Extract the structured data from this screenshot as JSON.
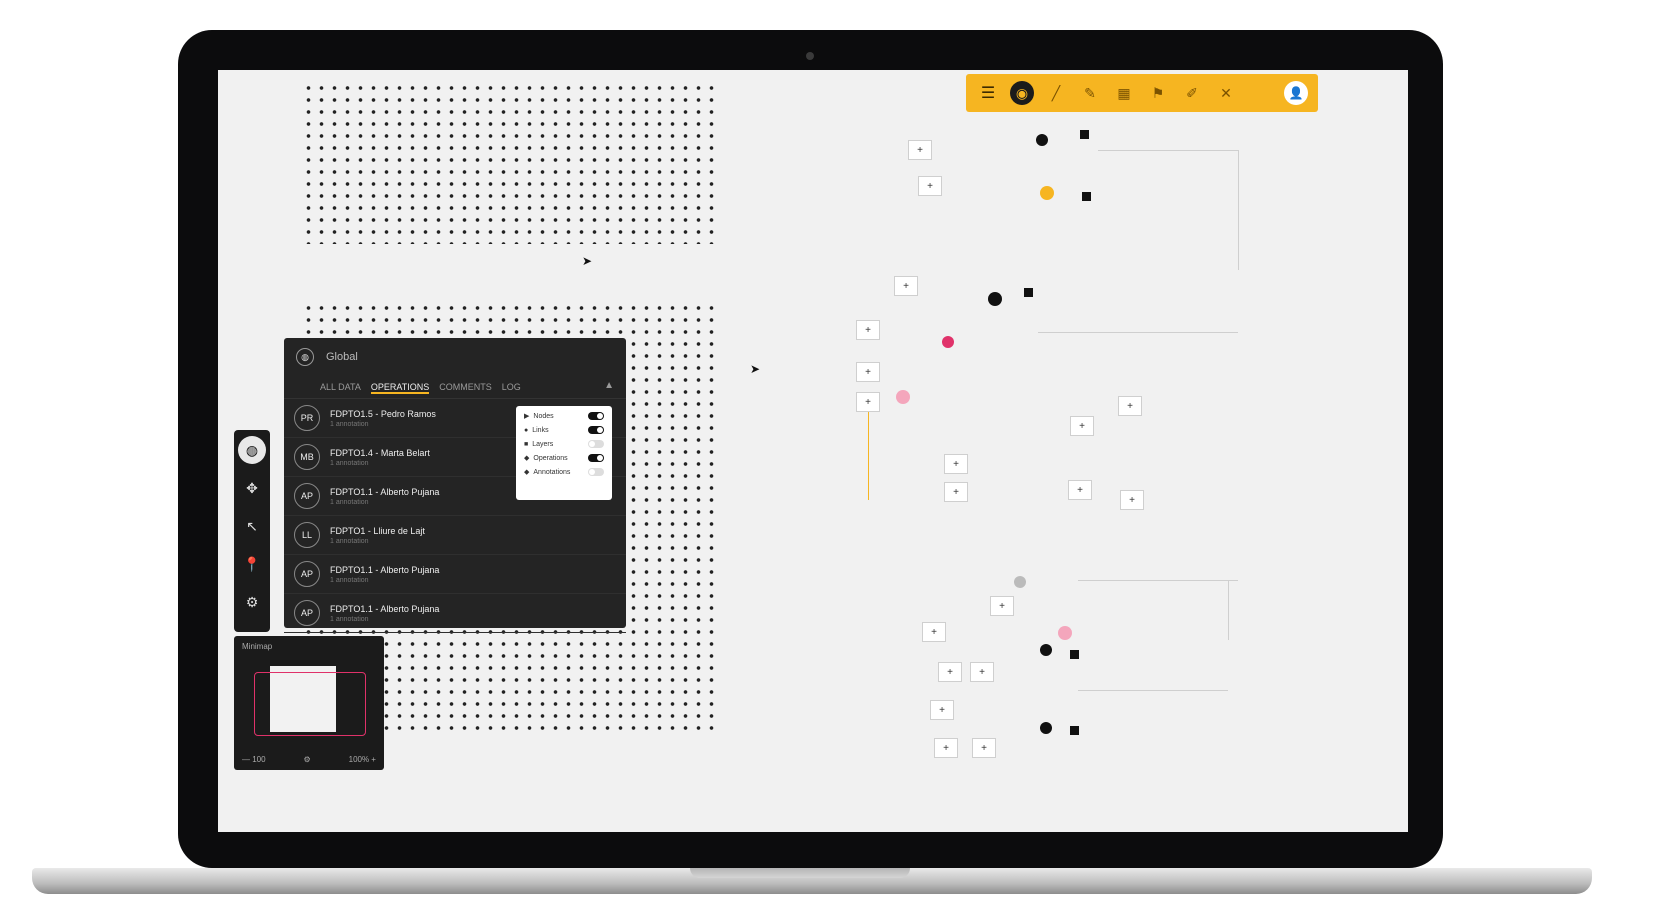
{
  "toolbar": {
    "icons": [
      "layers-icon",
      "target-icon",
      "slash-icon",
      "pen-icon",
      "grid-icon",
      "flag-icon",
      "pencil-icon",
      "close-icon",
      "user-icon"
    ]
  },
  "panel": {
    "title": "Global",
    "tabs": [
      "ALL DATA",
      "OPERATIONS",
      "COMMENTS",
      "LOG"
    ],
    "active_tab": 1,
    "rows": [
      {
        "initials": "PR",
        "title": "FDPTO1.5 - Pedro Ramos",
        "subtitle": "1 annotation"
      },
      {
        "initials": "MB",
        "title": "FDPTO1.4 - Marta Belart",
        "subtitle": "1 annotation"
      },
      {
        "initials": "AP",
        "title": "FDPTO1.1 - Alberto Pujana",
        "subtitle": "1 annotation"
      },
      {
        "initials": "LL",
        "title": "FDPTO1 - Lliure de Lajt",
        "subtitle": "1 annotation"
      },
      {
        "initials": "AP",
        "title": "FDPTO1.1 - Alberto Pujana",
        "subtitle": "1 annotation"
      },
      {
        "initials": "AP",
        "title": "FDPTO1.1 - Alberto Pujana",
        "subtitle": "1 annotation"
      }
    ]
  },
  "filters": {
    "items": [
      {
        "label": "Nodes",
        "on": true
      },
      {
        "label": "Links",
        "on": true
      },
      {
        "label": "Layers",
        "on": false
      },
      {
        "label": "Operations",
        "on": true
      },
      {
        "label": "Annotations",
        "on": false
      }
    ]
  },
  "minimap": {
    "title": "Minimap",
    "zoom_out": "— 100",
    "zoom_in": "100% +"
  },
  "colors": {
    "accent": "#f6b521",
    "highlight": "#e0326a",
    "panel_bg": "#242424"
  }
}
